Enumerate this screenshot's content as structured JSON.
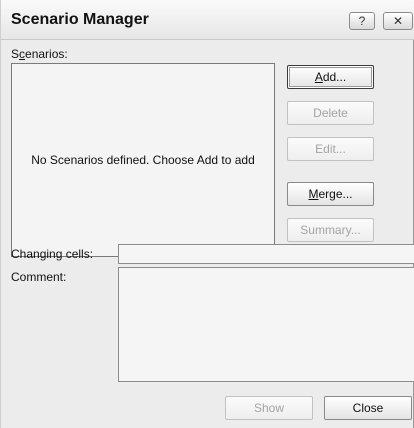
{
  "window": {
    "title": "Scenario Manager",
    "help_glyph": "?",
    "close_glyph": "✕"
  },
  "scenarios": {
    "label_pre": "S",
    "label_u": "c",
    "label_post": "enarios:",
    "empty_message": "No Scenarios defined. Choose Add to add"
  },
  "buttons": {
    "add_pre": "",
    "add_u": "A",
    "add_post": "dd...",
    "delete": "Delete",
    "edit": "Edit...",
    "merge_pre": "",
    "merge_u": "M",
    "merge_post": "erge...",
    "summary": "Summary...",
    "show": "Show",
    "close": "Close"
  },
  "fields": {
    "changing_cells_label": "Changing cells:",
    "changing_cells_value": "",
    "comment_label": "Comment:",
    "comment_value": ""
  },
  "icons": {
    "help": "help-icon",
    "close": "close-icon"
  }
}
